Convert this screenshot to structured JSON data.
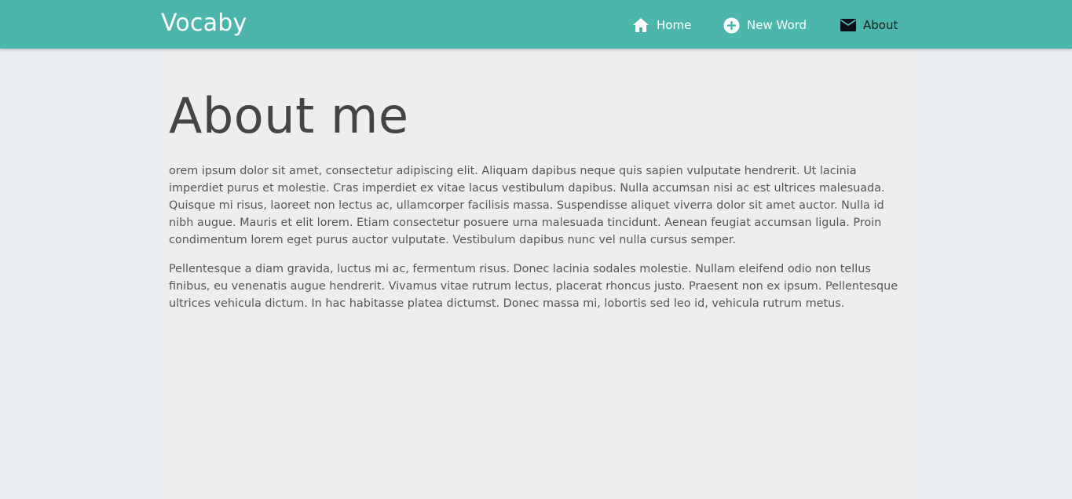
{
  "navbar": {
    "brand": "Vocaby",
    "items": [
      {
        "label": "Home",
        "icon": "home-icon"
      },
      {
        "label": "New Word",
        "icon": "add-circle-icon"
      },
      {
        "label": "About",
        "icon": "mail-icon"
      }
    ],
    "background_color": "#4db6ac"
  },
  "main": {
    "title": "About me",
    "paragraphs": [
      "orem ipsum dolor sit amet, consectetur adipiscing elit. Aliquam dapibus neque quis sapien vulputate hendrerit. Ut lacinia imperdiet purus et molestie. Cras imperdiet ex vitae lacus vestibulum dapibus. Nulla accumsan nisi ac est ultrices malesuada. Quisque mi risus, laoreet non lectus ac, ullamcorper facilisis massa. Suspendisse aliquet viverra dolor sit amet auctor. Nulla id nibh augue. Mauris et elit lorem. Etiam consectetur posuere urna malesuada tincidunt. Aenean feugiat accumsan ligula. Proin condimentum lorem eget purus auctor vulputate. Vestibulum dapibus nunc vel nulla cursus semper.",
      "Pellentesque a diam gravida, luctus mi ac, fermentum risus. Donec lacinia sodales molestie. Nullam eleifend odio non tellus finibus, eu venenatis augue hendrerit. Vivamus vitae rutrum lectus, placerat rhoncus justo. Praesent non ex ipsum. Pellentesque ultrices vehicula dictum. In hac habitasse platea dictumst. Donec massa mi, lobortis sed leo id, vehicula rutrum metus."
    ]
  }
}
